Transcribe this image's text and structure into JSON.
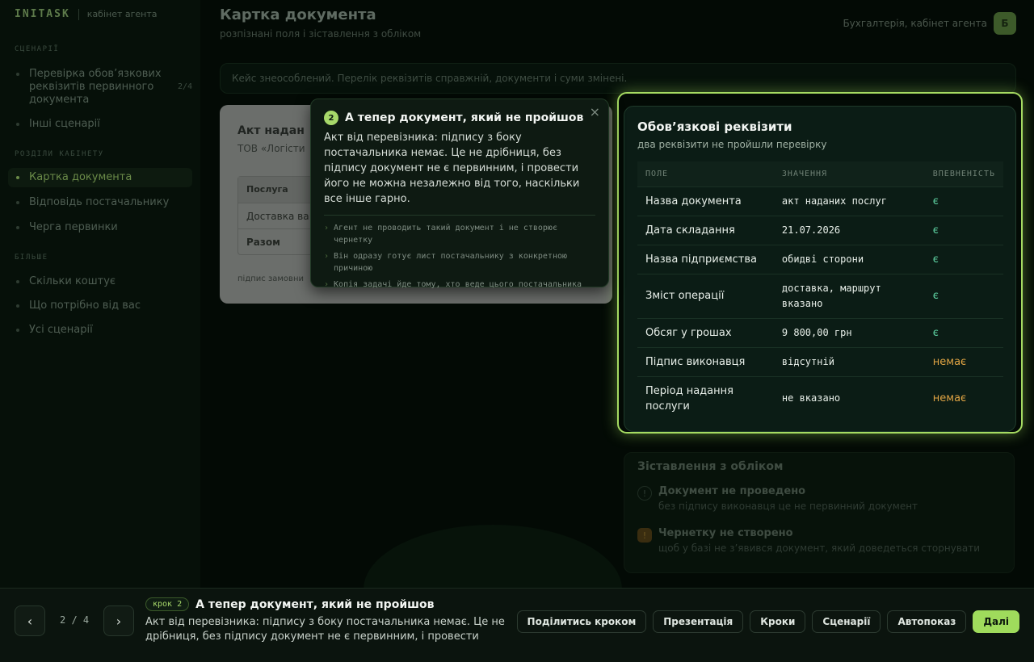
{
  "brand": {
    "name": "INITASK",
    "sub": "кабінет агента"
  },
  "sidebar": {
    "sections": [
      {
        "label": "СЦЕНАРІЇ"
      },
      {
        "label": "РОЗДІЛИ КАБІНЕТУ"
      },
      {
        "label": "БІЛЬШЕ"
      }
    ],
    "scenarios": [
      {
        "label": "Перевірка обов’язкових реквізитів первинного документа",
        "count": "2/4"
      },
      {
        "label": "Інші сценарії"
      }
    ],
    "sections_items": [
      {
        "label": "Картка документа",
        "active": true
      },
      {
        "label": "Відповідь постачальнику"
      },
      {
        "label": "Черга первинки"
      }
    ],
    "more_items": [
      {
        "label": "Скільки коштує"
      },
      {
        "label": "Що потрібно від вас"
      },
      {
        "label": "Усі сценарії"
      }
    ]
  },
  "header": {
    "title": "Картка документа",
    "subtitle": "розпізнані поля і зіставлення з обліком",
    "user": "Бухгалтерія, кабінет агента",
    "avatar": "Б"
  },
  "banner": "Кейс знеособлений. Перелік реквізитів справжній, документи і суми змінені.",
  "doc": {
    "title": "Акт надан",
    "org": "ТОВ «Логісти",
    "rows": [
      "Послуга",
      "Доставка ва",
      "Разом"
    ],
    "footer": "підпис замовни"
  },
  "tooltip": {
    "step": "2",
    "title": "А тепер документ, який не пройшов",
    "close": "×",
    "body": "Акт від перевізника: підпису з боку постачальника немає. Це не дрібниця, без підпису документ не є первинним, і провести його не можна незалежно від того, наскільки все інше гарно.",
    "bullets": [
      "Агент не проводить такий документ і не створює чернетку",
      "Він одразу готує лист постачальнику з конкретною причиною",
      "Копія задачі йде тому, хто веде цього постачальника"
    ]
  },
  "requisites": {
    "title": "Обов’язкові реквізити",
    "subtitle": "два реквізити не пройшли перевірку",
    "columns": [
      "ПОЛЕ",
      "ЗНАЧЕННЯ",
      "ВПЕВНЕНІСТЬ"
    ],
    "rows": [
      {
        "field": "Назва документа",
        "value": "акт наданих послуг",
        "status": "є",
        "ok": true
      },
      {
        "field": "Дата складання",
        "value": "21.07.2026",
        "status": "є",
        "ok": true
      },
      {
        "field": "Назва підприємства",
        "value": "обидві сторони",
        "status": "є",
        "ok": true
      },
      {
        "field": "Зміст операції",
        "value": "доставка, маршрут вказано",
        "status": "є",
        "ok": true
      },
      {
        "field": "Обсяг у грошах",
        "value": "9 800,00 грн",
        "status": "є",
        "ok": true
      },
      {
        "field": "Підпис виконавця",
        "value": "відсутній",
        "status": "немає",
        "ok": false
      },
      {
        "field": "Період надання послуги",
        "value": "не вказано",
        "status": "немає",
        "ok": false
      }
    ]
  },
  "matching": {
    "title": "Зіставлення з обліком",
    "items": [
      {
        "icon": "!",
        "title": "Документ не проведено",
        "desc": "без підпису виконавця це не первинний документ"
      },
      {
        "icon": "!",
        "title": "Чернетку не створено",
        "desc": "щоб у базі не з’явився документ, який доведеться сторнувати"
      }
    ]
  },
  "bottom": {
    "prev": "‹",
    "next": "›",
    "counter": "2 / 4",
    "chip": "крок 2",
    "title": "А тепер документ, який не пройшов",
    "desc": "Акт від перевізника: підпису з боку постачальника немає. Це не дрібниця, без підпису документ не є первинним, і провести його…",
    "actions": [
      "Поділитись кроком",
      "Презентація",
      "Кроки",
      "Сценарії",
      "Автопоказ",
      "Далі"
    ]
  },
  "colors": {
    "accent": "#a6db62",
    "ok": "#5dcfa0",
    "bad": "#e0a444"
  }
}
